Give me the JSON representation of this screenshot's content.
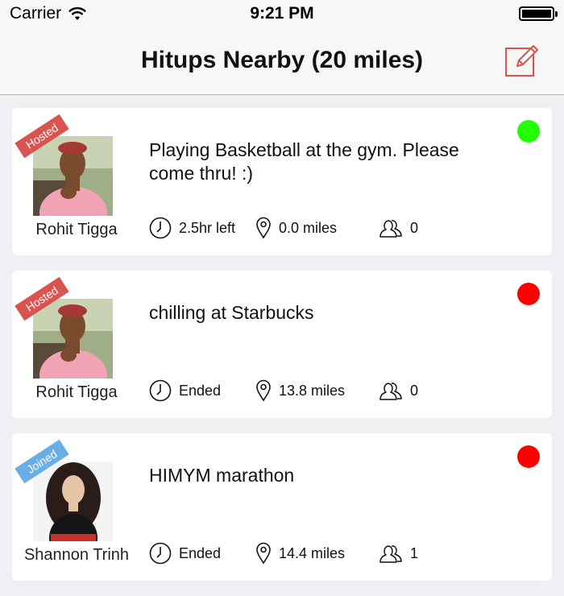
{
  "status_bar": {
    "carrier": "Carrier",
    "time": "9:21 PM"
  },
  "nav": {
    "title": "Hitups Nearby (20 miles)",
    "compose_icon": "compose-icon"
  },
  "colors": {
    "accent": "#d9534f",
    "hosted_badge": "#d9534f",
    "joined_badge": "#6aaee7",
    "status_active": "#22ff00",
    "status_ended": "#ff0000"
  },
  "hitups": [
    {
      "badge": "Hosted",
      "user": "Rohit Tigga",
      "title": "Playing Basketball at the gym. Please come thru! :)",
      "time": "2.5hr left",
      "distance": "0.0 miles",
      "attendees": "0",
      "status": "active"
    },
    {
      "badge": "Hosted",
      "user": "Rohit Tigga",
      "title": "chilling at Starbucks",
      "time": "Ended",
      "distance": "13.8 miles",
      "attendees": "0",
      "status": "ended"
    },
    {
      "badge": "Joined",
      "user": "Shannon Trinh",
      "title": "HIMYM marathon",
      "time": "Ended",
      "distance": "14.4 miles",
      "attendees": "1",
      "status": "ended"
    }
  ]
}
